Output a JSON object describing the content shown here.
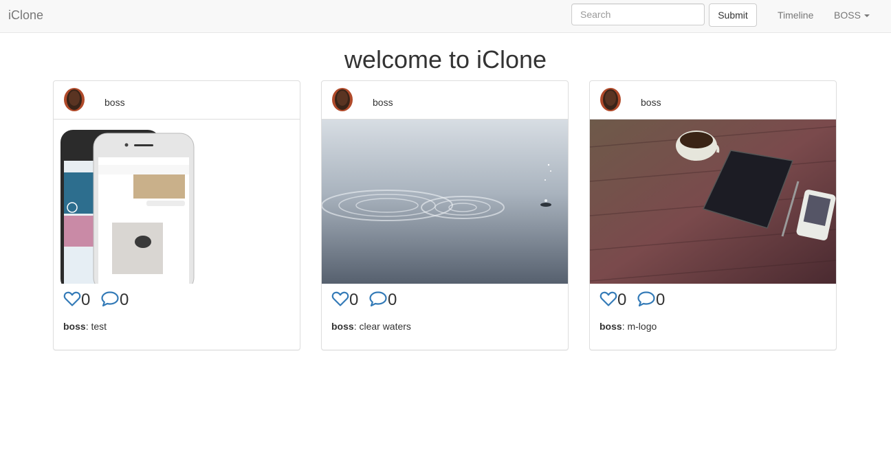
{
  "navbar": {
    "brand": "iClone",
    "search_placeholder": "Search",
    "submit_label": "Submit",
    "timeline_label": "Timeline",
    "user_menu_label": "BOSS"
  },
  "page": {
    "title": "welcome to iClone"
  },
  "posts": [
    {
      "author": "boss",
      "likes": "0",
      "comments": "0",
      "caption_user": "boss",
      "caption_text": ": test",
      "image": "phone-chat-screenshot"
    },
    {
      "author": "boss",
      "likes": "0",
      "comments": "0",
      "caption_user": "boss",
      "caption_text": ": clear waters",
      "image": "water-ripples-photo"
    },
    {
      "author": "boss",
      "likes": "0",
      "comments": "0",
      "caption_user": "boss",
      "caption_text": ": m-logo",
      "image": "coffee-tablet-desk-photo"
    }
  ],
  "icons": {
    "like": "heart-icon",
    "comment": "speech-bubble-icon"
  },
  "colors": {
    "icon_blue": "#337ab7",
    "navbar_bg": "#f8f8f8"
  }
}
